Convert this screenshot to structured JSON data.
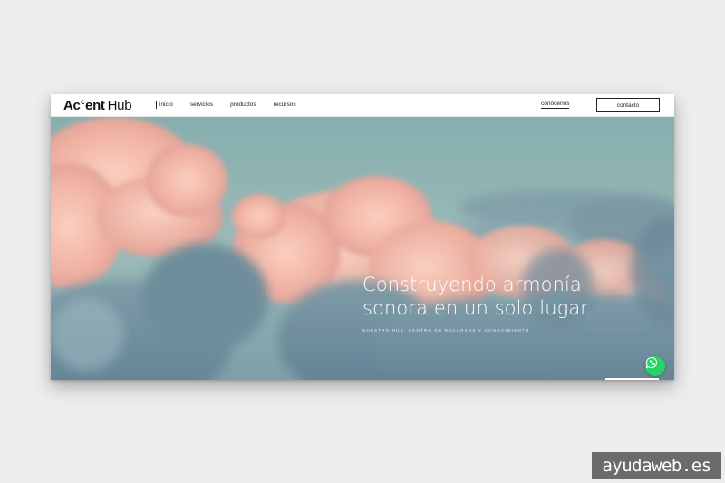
{
  "brand": {
    "logo_bold_prefix": "Ac",
    "logo_superscript": "c",
    "logo_bold_suffix": "ent",
    "logo_light": "Hub"
  },
  "nav": {
    "links": [
      "inicio",
      "servicios",
      "productos",
      "recursos"
    ],
    "about_link": "conócenos",
    "contact_button": "contacto"
  },
  "hero": {
    "headline_line1": "Construyendo armonía",
    "headline_line2": "sonora en un solo lugar.",
    "subline": "NUESTRO HUB: CENTRO DE RECURSOS Y CONOCIMIENTO",
    "background_image": "pink-and-blue-clouds-sky"
  },
  "widgets": {
    "chat_icon": "whatsapp-icon",
    "chat_color": "#25d366"
  },
  "watermark": {
    "text": "ayudaweb.es"
  },
  "colors": {
    "page_background": "#ededed",
    "sky_teal": "#8fb3b3",
    "cloud_pink": "#f2b8a6",
    "cloud_shadow": "#6e8f9e"
  }
}
